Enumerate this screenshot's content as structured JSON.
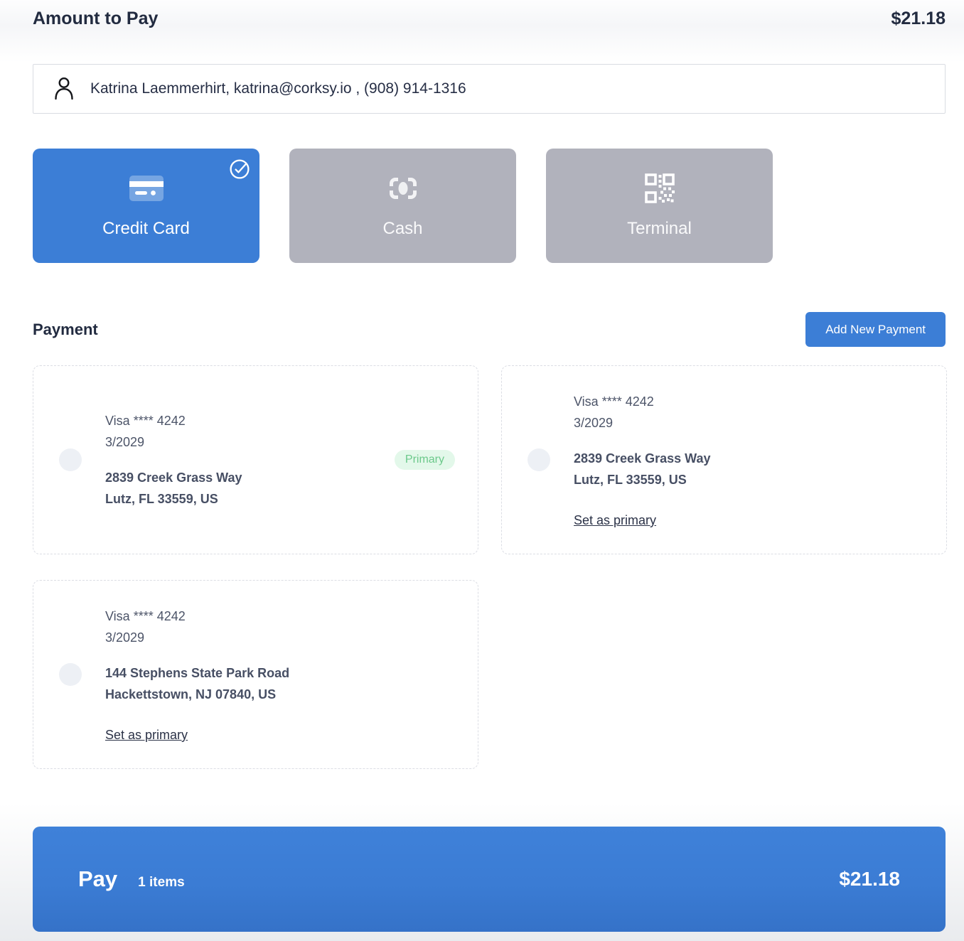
{
  "header": {
    "title": "Amount to Pay",
    "amount": "$21.18"
  },
  "customer": {
    "text": "Katrina Laemmerhirt, katrina@corksy.io , (908) 914-1316",
    "icon": "person-icon"
  },
  "payment_methods": [
    {
      "label": "Credit Card",
      "icon": "credit-card-icon",
      "selected": true
    },
    {
      "label": "Cash",
      "icon": "cash-icon",
      "selected": false
    },
    {
      "label": "Terminal",
      "icon": "qr-code-icon",
      "selected": false
    }
  ],
  "payment_section": {
    "title": "Payment",
    "add_button": "Add New Payment"
  },
  "cards": [
    {
      "name": "Visa **** 4242",
      "exp": "3/2029",
      "address1": "2839 Creek Grass Way",
      "address2": "Lutz, FL 33559, US",
      "badge": "Primary"
    },
    {
      "name": "Visa **** 4242",
      "exp": "3/2029",
      "address1": "2839 Creek Grass Way",
      "address2": "Lutz, FL 33559, US",
      "link": "Set as primary"
    },
    {
      "name": "Visa **** 4242",
      "exp": "3/2029",
      "address1": "144 Stephens State Park Road",
      "address2": "Hackettstown, NJ 07840, US",
      "link": "Set as primary"
    }
  ],
  "pay_bar": {
    "label": "Pay",
    "items": "1 items",
    "amount": "$21.18"
  },
  "colors": {
    "accent_blue": "#3c7ed6",
    "method_inactive_gray": "#b1b2bc",
    "badge_bg": "#e3f8ea",
    "badge_text": "#6cc98b",
    "text_navy": "#222b40",
    "card_text": "#4c5468",
    "card_border": "#dbdde4"
  }
}
